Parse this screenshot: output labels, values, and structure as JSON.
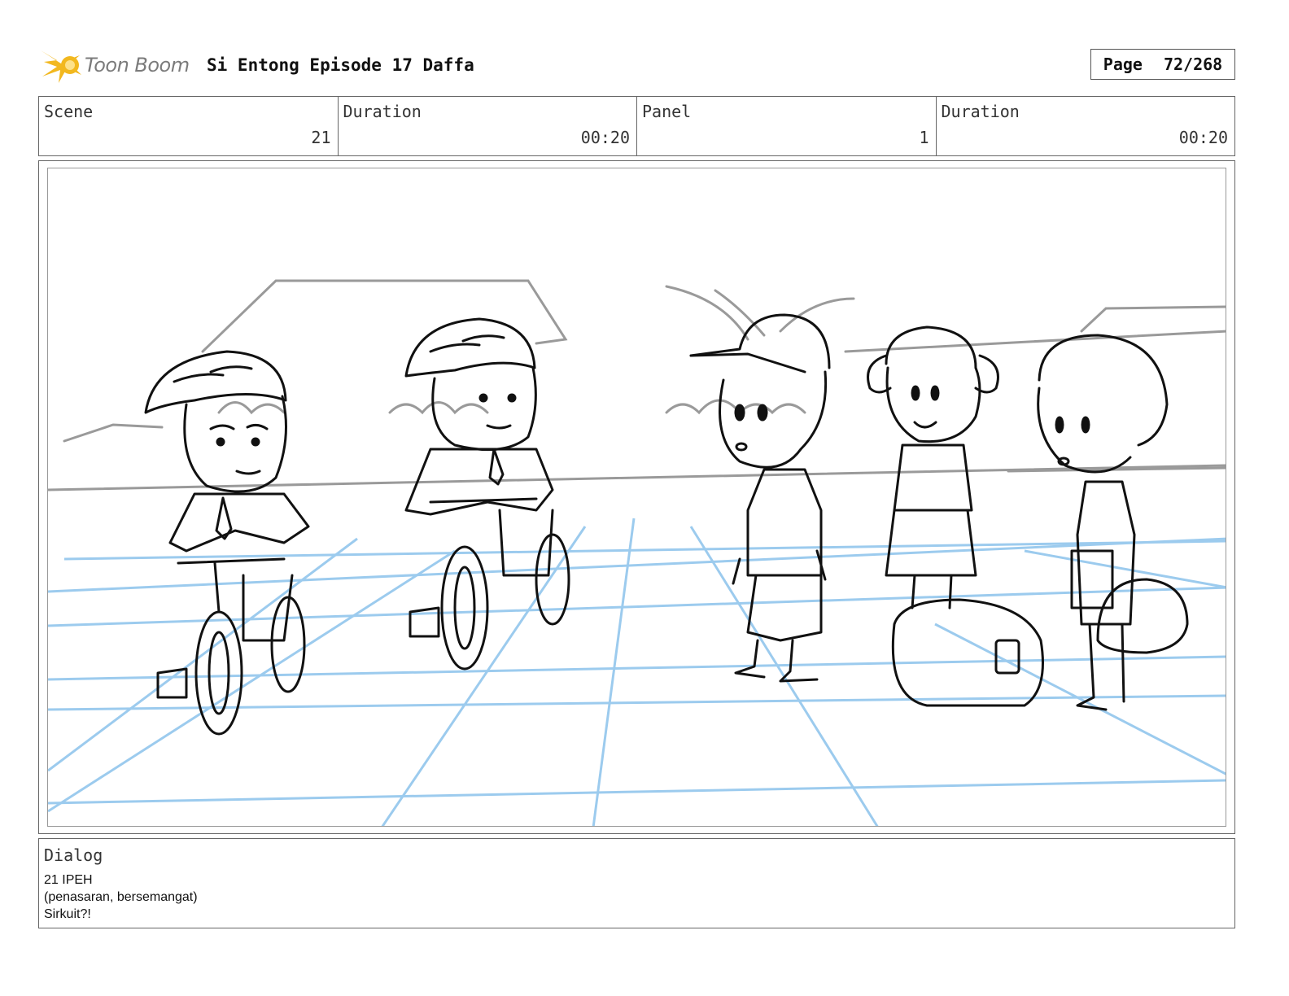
{
  "header": {
    "logo_text": "Toon Boom",
    "title": "Si Entong Episode 17 Daffa",
    "page_label": "Page",
    "page_value": "72/268"
  },
  "info": {
    "scene_label": "Scene",
    "scene_value": "21",
    "scene_duration_label": "Duration",
    "scene_duration_value": "00:20",
    "panel_label": "Panel",
    "panel_value": "1",
    "panel_duration_label": "Duration",
    "panel_duration_value": "00:20"
  },
  "dialog": {
    "label": "Dialog",
    "lines": [
      "21 IPEH",
      "(penasaran, bersemangat)",
      "Sirkuit?!"
    ]
  },
  "colors": {
    "logo_yellow": "#f2b81f",
    "perspective_grid": "#9ccbee",
    "sketch_line": "#111111",
    "background_sketch": "#9a9a9a"
  }
}
